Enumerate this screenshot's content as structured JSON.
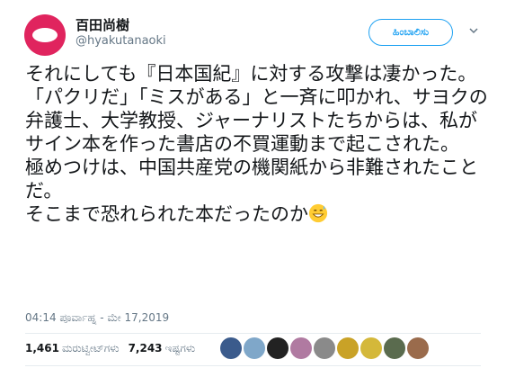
{
  "user": {
    "display_name": "百田尚樹",
    "handle": "@hyakutanaoki"
  },
  "follow_button": {
    "label": "ಹಿಂಬಾಲಿಸು"
  },
  "tweet": {
    "text": "それにしても『日本国紀』に対する攻撃は凄かった。\n「パクリだ」「ミスがある」と一斉に叩かれ、サヨクの弁護士、大学教授、ジャーナリストたちからは、私がサイン本を作った書店の不買運動まで起こされた。\n極めつけは、中国共産党の機関紙から非難されたことだ。\nそこまで恐れられた本だったのか",
    "emoji": "grinning-face-with-sweat",
    "timestamp": "04:14 ಪೂರ್ವಾಹ್ನ - ಮೇ 17,2019"
  },
  "stats": {
    "retweets_count": "1,461",
    "retweets_label": "ಮರುಟ್ವೀಟ್‌ಗಳು",
    "likes_count": "7,243",
    "likes_label": "ಇಷ್ಟಗಳು"
  },
  "likers": [
    {
      "color": "#3b5b8c"
    },
    {
      "color": "#7fa7c9"
    },
    {
      "color": "#222222"
    },
    {
      "color": "#b07aa1"
    },
    {
      "color": "#8a8a8a"
    },
    {
      "color": "#c9a227"
    },
    {
      "color": "#d4b83a"
    },
    {
      "color": "#5a6b4e"
    },
    {
      "color": "#9a6b4c"
    }
  ],
  "colors": {
    "accent": "#1da1f2",
    "avatar": "#e0245e",
    "muted": "#657786"
  }
}
